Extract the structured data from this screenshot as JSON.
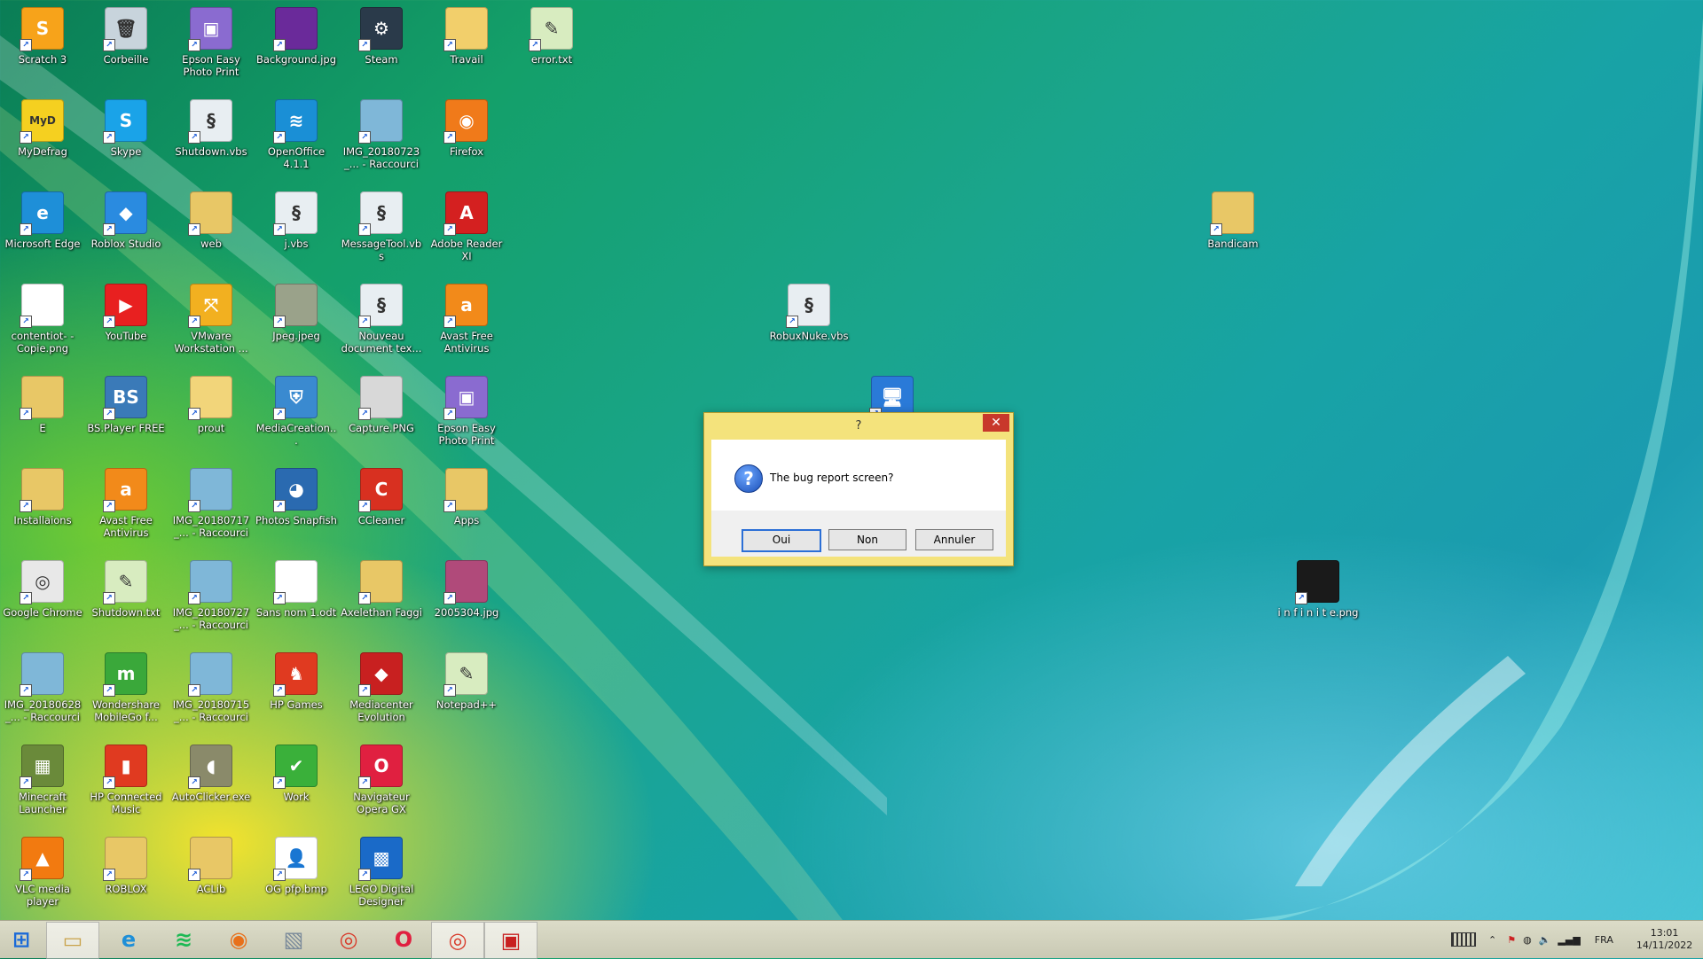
{
  "desktop": {
    "icons": [
      {
        "label": "Scratch 3",
        "icon": "scratch-icon",
        "color": "#f7a31a",
        "glyph": "S"
      },
      {
        "label": "Corbeille",
        "icon": "recycle-bin-icon",
        "color": "#c8d4dc",
        "glyph": "🗑"
      },
      {
        "label": "Epson Easy Photo Print",
        "icon": "epson-photo-print-icon",
        "color": "#8a6bd0",
        "glyph": "▣"
      },
      {
        "label": "Background.jpg",
        "icon": "image-file-icon",
        "color": "#6a2a9a",
        "glyph": ""
      },
      {
        "label": "Steam",
        "icon": "steam-icon",
        "color": "#2a3a4a",
        "glyph": "⚙"
      },
      {
        "label": "Travail",
        "icon": "folder-icon",
        "color": "#f2cf6b",
        "glyph": ""
      },
      {
        "label": "error.txt",
        "icon": "text-file-icon",
        "color": "#d8ecc0",
        "glyph": "✎"
      },
      {
        "label": "MyDefrag",
        "icon": "mydefrag-icon",
        "color": "#f5d020",
        "glyph": "MyD"
      },
      {
        "label": "Skype",
        "icon": "skype-icon",
        "color": "#1aa3e8",
        "glyph": "S"
      },
      {
        "label": "Shutdown.vbs",
        "icon": "vbs-script-icon",
        "color": "#e8eef2",
        "glyph": "§"
      },
      {
        "label": "OpenOffice 4.1.1",
        "icon": "openoffice-icon",
        "color": "#1a8fd6",
        "glyph": "≋"
      },
      {
        "label": "IMG_20180723_... - Raccourci",
        "icon": "image-shortcut-icon",
        "color": "#7fb7d8",
        "glyph": ""
      },
      {
        "label": "Firefox",
        "icon": "firefox-icon",
        "color": "#f07a1a",
        "glyph": "◉"
      },
      {
        "label": "Microsoft Edge",
        "icon": "edge-icon",
        "color": "#1e8fd8",
        "glyph": "e"
      },
      {
        "label": "Roblox Studio",
        "icon": "roblox-studio-icon",
        "color": "#2a8be0",
        "glyph": "◆"
      },
      {
        "label": "web",
        "icon": "folder-icon",
        "color": "#e8c766",
        "glyph": ""
      },
      {
        "label": "j.vbs",
        "icon": "vbs-script-icon",
        "color": "#e8eef2",
        "glyph": "§"
      },
      {
        "label": "MessageTool.vbs",
        "icon": "vbs-script-icon",
        "color": "#e8eef2",
        "glyph": "§"
      },
      {
        "label": "Adobe Reader XI",
        "icon": "adobe-reader-icon",
        "color": "#d42020",
        "glyph": "A"
      },
      {
        "label": "contentiot- - Copie.png",
        "icon": "image-file-icon",
        "color": "#ffffff",
        "glyph": ""
      },
      {
        "label": "YouTube",
        "icon": "youtube-icon",
        "color": "#e82020",
        "glyph": "▶"
      },
      {
        "label": "VMware Workstation ...",
        "icon": "vmware-icon",
        "color": "#f2b020",
        "glyph": "⤧"
      },
      {
        "label": "Jpeg.jpeg",
        "icon": "image-file-icon",
        "color": "#9aa28a",
        "glyph": ""
      },
      {
        "label": "Nouveau document tex...",
        "icon": "vbs-script-icon",
        "color": "#e8eef2",
        "glyph": "§"
      },
      {
        "label": "Avast Free Antivirus",
        "icon": "avast-icon",
        "color": "#f28a1a",
        "glyph": "a"
      },
      {
        "label": "E",
        "icon": "folder-icon",
        "color": "#e8c766",
        "glyph": ""
      },
      {
        "label": "BS.Player FREE",
        "icon": "bsplayer-icon",
        "color": "#3a7ab8",
        "glyph": "BS"
      },
      {
        "label": "prout",
        "icon": "folder-icon",
        "color": "#f2d57a",
        "glyph": ""
      },
      {
        "label": "MediaCreation...",
        "icon": "media-creation-icon",
        "color": "#3a8ad0",
        "glyph": "⛨"
      },
      {
        "label": "Capture.PNG",
        "icon": "image-file-icon",
        "color": "#d8d8d8",
        "glyph": ""
      },
      {
        "label": "Epson Easy Photo Print",
        "icon": "epson-photo-print-icon",
        "color": "#8a6bd0",
        "glyph": "▣"
      },
      {
        "label": "Installaions",
        "icon": "folder-icon",
        "color": "#e8c766",
        "glyph": ""
      },
      {
        "label": "Avast Free Antivirus",
        "icon": "avast-icon",
        "color": "#f28a1a",
        "glyph": "a"
      },
      {
        "label": "IMG_20180717_... - Raccourci",
        "icon": "image-shortcut-icon",
        "color": "#7fb7d8",
        "glyph": ""
      },
      {
        "label": "Photos Snapfish",
        "icon": "snapfish-icon",
        "color": "#2a6ab0",
        "glyph": "◕"
      },
      {
        "label": "CCleaner",
        "icon": "ccleaner-icon",
        "color": "#d83020",
        "glyph": "C"
      },
      {
        "label": "Apps",
        "icon": "folder-icon",
        "color": "#e8c766",
        "glyph": ""
      },
      {
        "label": "Google Chrome",
        "icon": "chrome-icon",
        "color": "#e8e8e8",
        "glyph": "◎"
      },
      {
        "label": "Shutdown.txt",
        "icon": "text-file-icon",
        "color": "#d8ecc0",
        "glyph": "✎"
      },
      {
        "label": "IMG_20180727_... - Raccourci",
        "icon": "image-shortcut-icon",
        "color": "#7fb7d8",
        "glyph": ""
      },
      {
        "label": "Sans nom 1.odt",
        "icon": "document-file-icon",
        "color": "#ffffff",
        "glyph": ""
      },
      {
        "label": "Axelethan Faggi",
        "icon": "user-folder-icon",
        "color": "#e8c766",
        "glyph": ""
      },
      {
        "label": "2005304.jpg",
        "icon": "image-file-icon",
        "color": "#b04a7a",
        "glyph": ""
      },
      {
        "label": "IMG_20180628_... - Raccourci",
        "icon": "image-shortcut-icon",
        "color": "#7fb7d8",
        "glyph": ""
      },
      {
        "label": "Wondershare MobileGo f...",
        "icon": "mobilego-icon",
        "color": "#3aa83a",
        "glyph": "m"
      },
      {
        "label": "IMG_20180715_... - Raccourci",
        "icon": "image-shortcut-icon",
        "color": "#7fb7d8",
        "glyph": ""
      },
      {
        "label": "HP Games",
        "icon": "hp-games-icon",
        "color": "#e03a20",
        "glyph": "♞"
      },
      {
        "label": "Mediacenter Evolution",
        "icon": "mediacenter-icon",
        "color": "#c82020",
        "glyph": "◆"
      },
      {
        "label": "Notepad++",
        "icon": "notepad-plus-icon",
        "color": "#d8ecc0",
        "glyph": "✎"
      },
      {
        "label": "Minecraft Launcher",
        "icon": "minecraft-icon",
        "color": "#6a8a3a",
        "glyph": "▦"
      },
      {
        "label": "HP Connected Music",
        "icon": "hp-music-icon",
        "color": "#e03a20",
        "glyph": "▮"
      },
      {
        "label": "AutoClicker.exe",
        "icon": "mouse-icon",
        "color": "#8a8a6a",
        "glyph": "◖"
      },
      {
        "label": "Work",
        "icon": "checkmark-icon",
        "color": "#3ab03a",
        "glyph": "✔"
      },
      {
        "label": "Navigateur Opera GX",
        "icon": "opera-gx-icon",
        "color": "#e02040",
        "glyph": "O"
      },
      {
        "label": "VLC media player",
        "icon": "vlc-icon",
        "color": "#f27a10",
        "glyph": "▲"
      },
      {
        "label": "ROBLOX",
        "icon": "folder-icon",
        "color": "#e8c766",
        "glyph": ""
      },
      {
        "label": "ACLib",
        "icon": "folder-icon",
        "color": "#e8c766",
        "glyph": ""
      },
      {
        "label": "OG pfp.bmp",
        "icon": "avatar-image-icon",
        "color": "#ffffff",
        "glyph": "👤"
      },
      {
        "label": "LEGO Digital Designer",
        "icon": "lego-icon",
        "color": "#1a6ac8",
        "glyph": "▩"
      },
      {
        "label": "Bandicam",
        "icon": "folder-icon",
        "color": "#e8c766",
        "glyph": ""
      },
      {
        "label": "RobuxNuke.vbs",
        "icon": "vbs-script-icon",
        "color": "#e8eef2",
        "glyph": "§"
      },
      {
        "label": "",
        "icon": "computer-icon",
        "color": "#2a7ad8",
        "glyph": "🖥"
      },
      {
        "label": "i n f i n i t e.png",
        "icon": "image-file-icon",
        "color": "#1a1a1a",
        "glyph": ""
      }
    ]
  },
  "dialog": {
    "title": "?",
    "close_glyph": "✕",
    "message": "The bug report screen?",
    "buttons": {
      "yes": "Oui",
      "no": "Non",
      "cancel": "Annuler"
    }
  },
  "taskbar": {
    "items": [
      {
        "name": "start-button",
        "icon": "windows-icon",
        "active": false
      },
      {
        "name": "file-explorer",
        "icon": "folder-icon",
        "active": true
      },
      {
        "name": "microsoft-edge",
        "icon": "edge-icon",
        "active": false
      },
      {
        "name": "spotify",
        "icon": "spotify-icon",
        "active": false
      },
      {
        "name": "firefox",
        "icon": "firefox-icon",
        "active": false
      },
      {
        "name": "photo-viewer",
        "icon": "photo-viewer-icon",
        "active": false
      },
      {
        "name": "google-chrome",
        "icon": "chrome-icon",
        "active": false
      },
      {
        "name": "opera-gx",
        "icon": "opera-gx-icon",
        "active": false
      },
      {
        "name": "google-chrome-profile",
        "icon": "chrome-icon",
        "active": true
      },
      {
        "name": "script-host",
        "icon": "script-app-icon",
        "active": true
      }
    ],
    "tray": {
      "language": "FRA",
      "time": "13:01",
      "date": "14/11/2022"
    }
  }
}
